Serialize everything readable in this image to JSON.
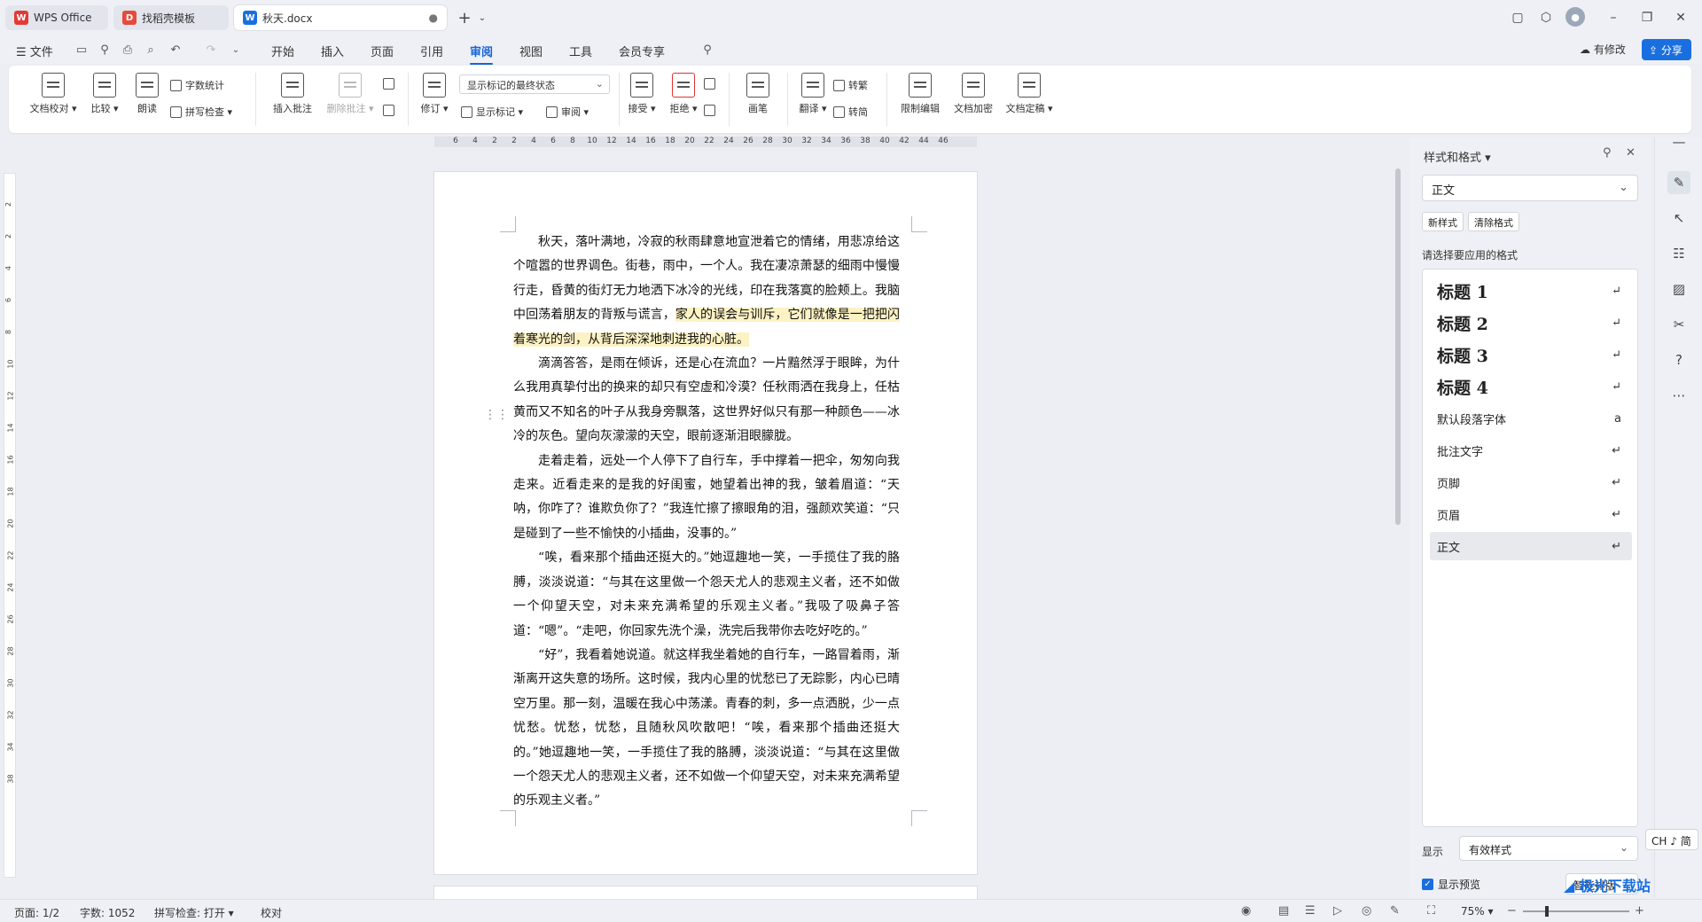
{
  "tabs": [
    {
      "label": "WPS Office",
      "icon": "wps-logo-icon"
    },
    {
      "label": "找稻壳模板",
      "icon": "docer-logo-icon"
    },
    {
      "label": "秋天.docx",
      "icon": "word-doc-icon"
    }
  ],
  "menu": {
    "file": "文件",
    "items": [
      "开始",
      "插入",
      "页面",
      "引用",
      "审阅",
      "视图",
      "工具",
      "会员专享"
    ],
    "active": "审阅",
    "modified": "有修改",
    "share": "分享"
  },
  "ribbon": {
    "doc_proof": "文档校对",
    "compare": "比较",
    "read_aloud": "朗读",
    "word_count": "字数统计",
    "spell_check": "拼写检查",
    "insert_comment": "插入批注",
    "delete_comment": "删除批注",
    "revise": "修订",
    "markup_select": "显示标记的最终状态",
    "show_markup": "显示标记",
    "review": "审阅",
    "accept": "接受",
    "reject": "拒绝",
    "pen": "画笔",
    "translate": "翻译",
    "to_traditional": "转繁",
    "to_simplified": "转简",
    "restrict_edit": "限制编辑",
    "encrypt": "文档加密",
    "finalize": "文档定稿"
  },
  "ruler": {
    "h_ticks": [
      "6",
      "4",
      "2",
      "2",
      "4",
      "6",
      "8",
      "10",
      "12",
      "14",
      "16",
      "18",
      "20",
      "22",
      "24",
      "26",
      "28",
      "30",
      "32",
      "34",
      "36",
      "38",
      "40",
      "42",
      "44",
      "46"
    ],
    "v_ticks": [
      "2",
      "2",
      "4",
      "6",
      "8",
      "10",
      "12",
      "14",
      "16",
      "18",
      "20",
      "22",
      "24",
      "26",
      "28",
      "30",
      "32",
      "34",
      "38"
    ]
  },
  "document": {
    "paragraphs": [
      {
        "before": "秋天，落叶满地，冷寂的秋雨肆意地宣泄着它的情绪，用悲凉给这个喧嚣的世界调色。街巷，雨中，一个人。我在凄凉萧瑟的细雨中慢慢行走，昏黄的街灯无力地洒下冰冷的光线，印在我落寞的脸颊上。我脑中回荡着朋友的背叛与谎言，",
        "highlight": "家人的误会与训斥，它们就像是一把把闪着寒光的剑，从背后深深地刺进我的心脏。"
      },
      {
        "text": "滴滴答答，是雨在倾诉，还是心在流血？一片黯然浮于眼眸，为什么我用真挚付出的换来的却只有空虚和冷漠？任秋雨洒在我身上，任枯黄而又不知名的叶子从我身旁飘落，这世界好似只有那一种颜色——冰冷的灰色。望向灰濛濛的天空，眼前逐渐泪眼朦胧。"
      },
      {
        "text": "走着走着，远处一个人停下了自行车，手中撑着一把伞，匆匆向我走来。近看走来的是我的好闺蜜，她望着出神的我，皱着眉道：“天呐，你咋了？谁欺负你了？”我连忙擦了擦眼角的泪，强颜欢笑道：“只是碰到了一些不愉快的小插曲，没事的。”"
      },
      {
        "text": "“唉，看来那个插曲还挺大的。”她逗趣地一笑，一手揽住了我的胳膊，淡淡说道：“与其在这里做一个怨天尤人的悲观主义者，还不如做一个仰望天空，对未来充满希望的乐观主义者。”我吸了吸鼻子答道：“嗯”。“走吧，你回家先洗个澡，洗完后我带你去吃好吃的。”"
      },
      {
        "text": "“好”，我看着她说道。就这样我坐着她的自行车，一路冒着雨，渐渐离开这失意的场所。这时候，我内心里的忧愁已了无踪影，内心已晴空万里。那一刻，温暖在我心中荡漾。青春的刺，多一点洒脱，少一点忧愁。忧愁，忧愁，且随秋风吹散吧！“唉，看来那个插曲还挺大的。”她逗趣地一笑，一手揽住了我的胳膊，淡淡说道：“与其在这里做一个怨天尤人的悲观主义者，还不如做一个仰望天空，对未来充满希望的乐观主义者。”"
      }
    ]
  },
  "style_panel": {
    "title": "样式和格式",
    "current_style": "正文",
    "new_style": "新样式",
    "clear_format": "清除格式",
    "apply_label": "请选择要应用的格式",
    "styles": [
      {
        "label": "标题 1",
        "kind": "heading",
        "mark": "↵"
      },
      {
        "label": "标题 2",
        "kind": "heading",
        "mark": "↵"
      },
      {
        "label": "标题 3",
        "kind": "heading",
        "mark": "↵"
      },
      {
        "label": "标题 4",
        "kind": "heading",
        "mark": "↵"
      },
      {
        "label": "默认段落字体",
        "kind": "normal",
        "mark": "a"
      },
      {
        "label": "批注文字",
        "kind": "normal",
        "mark": "↵"
      },
      {
        "label": "页脚",
        "kind": "normal",
        "mark": "↵"
      },
      {
        "label": "页眉",
        "kind": "normal",
        "mark": "↵"
      },
      {
        "label": "正文",
        "kind": "normal",
        "mark": "↵",
        "selected": true
      }
    ],
    "show_label": "显示",
    "show_value": "有效样式",
    "preview_label": "显示预览",
    "smart_layout": "智能排版"
  },
  "ime": "CH ♪ 简",
  "status": {
    "page": "页面: 1/2",
    "words": "字数: 1052",
    "spell": "拼写检查: 打开",
    "proof": "校对",
    "zoom": "75%",
    "zoom_level": 0.75
  },
  "watermark": "极光下载站",
  "colors": {
    "accent": "#1565d8",
    "highlight": "#fdf2c4"
  }
}
